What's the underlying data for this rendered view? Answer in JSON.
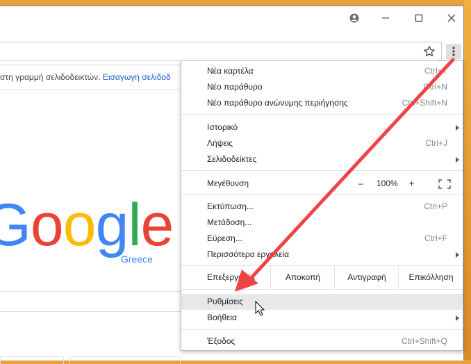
{
  "bookmarks_bar": {
    "text": "στη γραμμή σελιδοδεικτών.",
    "link": "Εισαγωγή σελιδοδ"
  },
  "logo": {
    "letters": [
      "G",
      "o",
      "o",
      "g",
      "l",
      "e"
    ],
    "colors": [
      "#4285f4",
      "#ea4335",
      "#fbbc05",
      "#4285f4",
      "#34a853",
      "#ea4335"
    ],
    "subtitle": "Greece"
  },
  "menu": {
    "new_tab": {
      "label": "Νέα καρτέλα",
      "shortcut": "Ctrl+T"
    },
    "new_window": {
      "label": "Νέο παράθυρο",
      "shortcut": "Ctrl+N"
    },
    "new_incognito": {
      "label": "Νέο παράθυρο ανώνυμης περιήγησης",
      "shortcut": "Ctrl+Shift+N"
    },
    "history": {
      "label": "Ιστορικό"
    },
    "downloads": {
      "label": "Λήψεις",
      "shortcut": "Ctrl+J"
    },
    "bookmarks": {
      "label": "Σελιδοδείκτες"
    },
    "zoom": {
      "label": "Μεγέθυνση",
      "minus": "–",
      "value": "100%",
      "plus": "+"
    },
    "print": {
      "label": "Εκτύπωση...",
      "shortcut": "Ctrl+P"
    },
    "cast": {
      "label": "Μετάδοση..."
    },
    "find": {
      "label": "Εύρεση...",
      "shortcut": "Ctrl+F"
    },
    "more_tools": {
      "label": "Περισσότερα εργαλεία"
    },
    "edit": {
      "label": "Επεξεργασία",
      "cut": "Αποκοπή",
      "copy": "Αντιγραφή",
      "paste": "Επικόλληση"
    },
    "settings": {
      "label": "Ρυθμίσεις"
    },
    "help": {
      "label": "Βοήθεια"
    },
    "exit": {
      "label": "Έξοδος",
      "shortcut": "Ctrl+Shift+Q"
    }
  },
  "annotation": {
    "arrow_color": "#ee4444"
  },
  "icons": {
    "profile": "profile-icon",
    "minimize": "minimize-icon",
    "maximize": "maximize-icon",
    "close": "close-icon",
    "star": "star-icon",
    "menu": "vertical-dots-icon",
    "fullscreen": "fullscreen-icon",
    "cursor": "mouse-cursor-icon"
  }
}
